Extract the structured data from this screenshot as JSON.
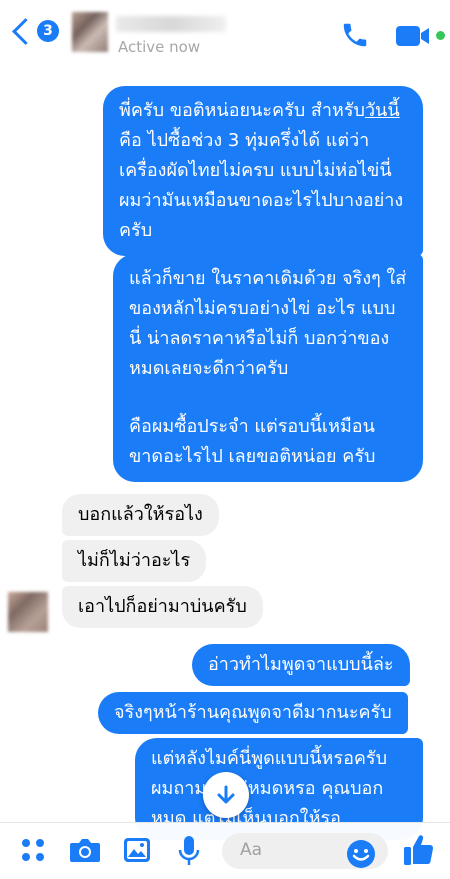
{
  "header": {
    "unread_count": "3",
    "status": "Active now"
  },
  "messages": {
    "out1": {
      "pre": "พี่ครับ ขอติหน่อยนะครับ สำหรับ",
      "link": "วันนี้",
      "post": " คือ ไปซื้อช่วง 3 ทุ่มครึ่งได้ แต่ว่าเครื่องผัดไทยไม่ครบ แบบไม่ห่อไข่นี่ผมว่ามันเหมือนขาดอะไรไปบางอย่างครับ"
    },
    "out2": {
      "p1": "แล้วก็ขาย ในราคาเดิมด้วย จริงๆ ใส่ของหลักไม่ครบอย่างไข่ อะไร แบบนี่ น่าลดราคาหรือไม่ก็ บอกว่าของหมดเลยจะดีกว่าครับ",
      "p2": "คือผมซื้อประจำ แต่รอบนี้เหมือนขาดอะไรไป เลยขอติหน่อย ครับ"
    },
    "in1": "บอกแล้วให้รอไง",
    "in2": "ไม่ก็ไม่ว่าอะไร",
    "in3": "เอาไปก็อย่ามาบ่นครับ",
    "out3": "อ่าวทำไมพูดจาแบบนี้ล่ะ",
    "out4": "จริงๆหน้าร้านคุณพูดจาดีมากนะครับ",
    "out5": "แต่หลังไมค์นี่พูดแบบนี้หรอครับ ผมถามว่าไข่หมดหรอ คุณบอก หมด แต่ไม่เห็นบอกให้รอ"
  },
  "composer": {
    "placeholder": "Aa"
  },
  "colors": {
    "accent": "#1a7cf7",
    "online": "#36c75a",
    "incoming_bg": "#f0f0f0"
  },
  "icons": [
    "back-chevron-icon",
    "phone-icon",
    "video-icon",
    "more-icon",
    "camera-icon",
    "gallery-icon",
    "mic-icon",
    "emoji-icon",
    "like-icon",
    "scroll-down-icon"
  ]
}
